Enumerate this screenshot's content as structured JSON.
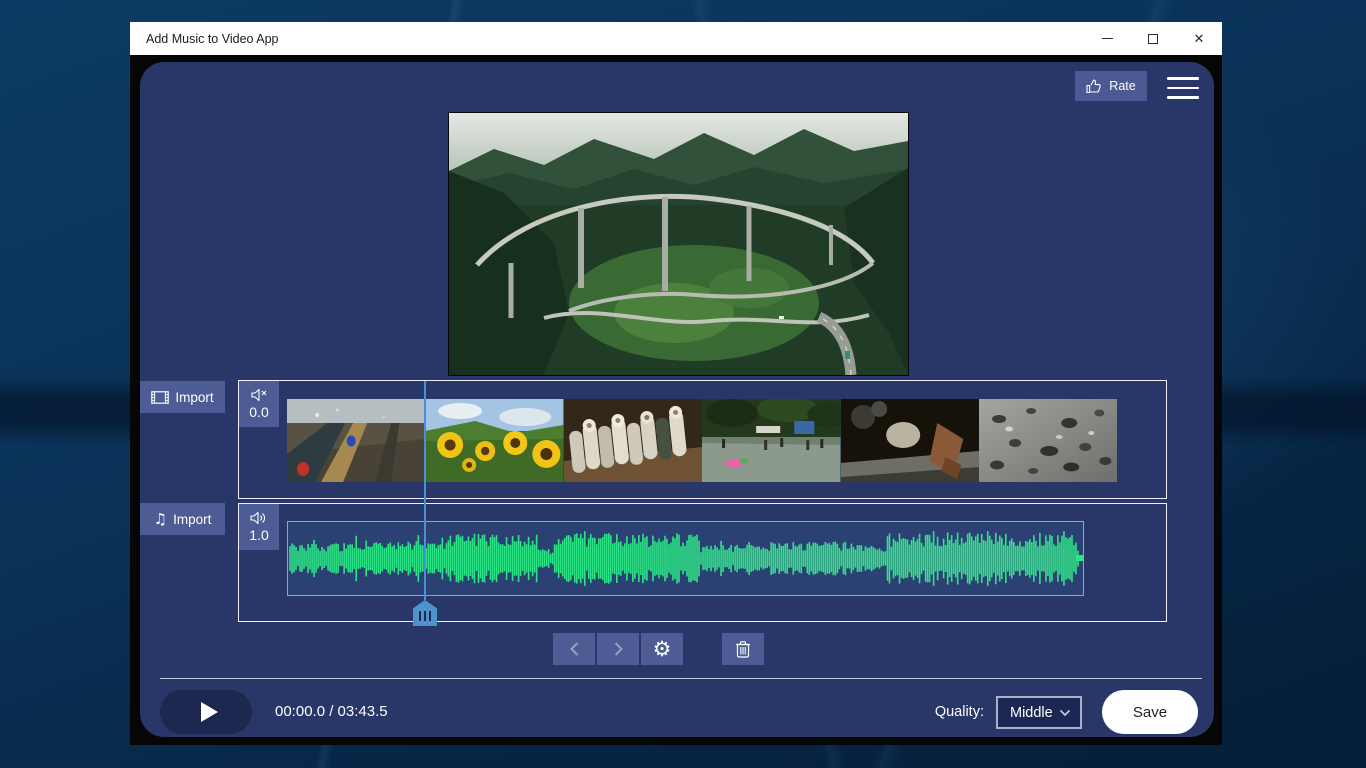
{
  "titlebar": {
    "title": "Add Music to Video App",
    "minimize_glyph": "",
    "close_glyph": "✕"
  },
  "header": {
    "rate_label": "Rate"
  },
  "tracks": {
    "video": {
      "import_label": "Import",
      "volume": "0.0",
      "muted": true
    },
    "audio": {
      "import_label": "Import",
      "volume": "1.0",
      "note_glyph": "♫"
    }
  },
  "transport": {
    "time": "00:00.0 / 03:43.5"
  },
  "footer": {
    "quality_label": "Quality:",
    "quality_value": "Middle",
    "save_label": "Save"
  },
  "icons": {
    "gear_glyph": "⚙",
    "names": [
      "thumbs-up-icon",
      "hamburger-menu-icon",
      "film-icon",
      "music-note-icon",
      "speaker-muted-icon",
      "speaker-on-icon",
      "chevron-left-icon",
      "chevron-right-icon",
      "gear-icon",
      "trash-icon",
      "play-icon",
      "chevron-down-icon"
    ]
  },
  "colors": {
    "panel": "#293768",
    "accent_green": "#2ee487",
    "playhead_blue": "#4a90d8",
    "button_blue": "#4d5c94",
    "dark_navy": "#1d2750"
  },
  "waveform_envelope": [
    [
      0.0,
      0.08,
      0.58
    ],
    [
      0.08,
      0.2,
      0.65
    ],
    [
      0.2,
      0.315,
      0.95
    ],
    [
      0.315,
      0.335,
      0.35
    ],
    [
      0.335,
      0.52,
      0.93
    ],
    [
      0.52,
      0.575,
      0.5
    ],
    [
      0.575,
      0.72,
      0.62
    ],
    [
      0.72,
      0.755,
      0.52
    ],
    [
      0.755,
      0.995,
      0.96
    ]
  ]
}
